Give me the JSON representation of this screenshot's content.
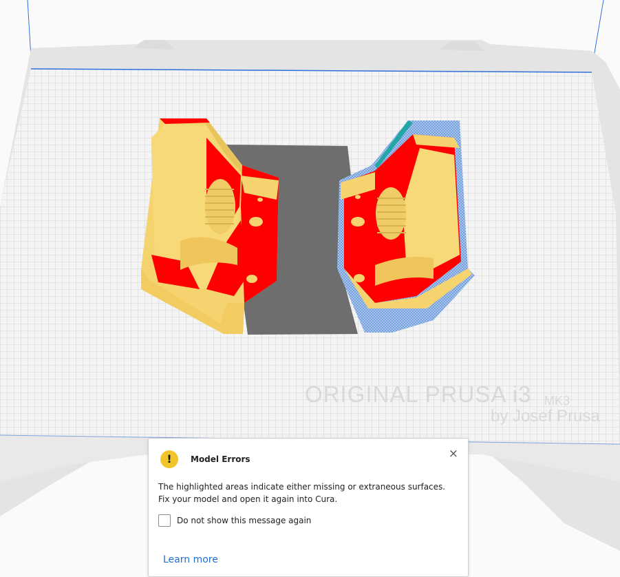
{
  "viewport": {
    "watermark_title": "ORIGINAL PRUSA i3",
    "watermark_model": "MK3",
    "watermark_by": "by Josef Prusa"
  },
  "colors": {
    "model_yellow": "#f5d36e",
    "overhang_red": "#ff0000",
    "error_mesh": "#7fcad8",
    "shadow": "#6e6e6e",
    "plate_frame": "#dcdcdc",
    "grid_line": "#d6d6d6",
    "frame_line": "#2f6fd9",
    "warning_yellow": "#f2c42b",
    "link_blue": "#1d6fd6"
  },
  "dialog": {
    "icon": "exclamation-icon",
    "icon_glyph": "!",
    "title": "Model Errors",
    "close_glyph": "×",
    "body_line1": "The highlighted areas indicate either missing or extraneous surfaces.",
    "body_line2": "Fix your model and open it again into Cura.",
    "checkbox_label": "Do not show this message again",
    "checkbox_checked": false,
    "learn_more": "Learn more"
  }
}
